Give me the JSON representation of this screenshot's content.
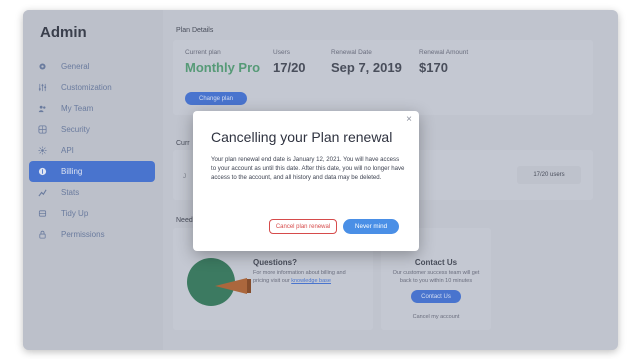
{
  "app": {
    "title": "Admin"
  },
  "sidebar": {
    "items": [
      {
        "label": "General",
        "icon": "gear-icon",
        "active": false
      },
      {
        "label": "Customization",
        "icon": "sliders-icon",
        "active": false
      },
      {
        "label": "My Team",
        "icon": "team-icon",
        "active": false
      },
      {
        "label": "Security",
        "icon": "shield-icon",
        "active": false
      },
      {
        "label": "API",
        "icon": "api-icon",
        "active": false
      },
      {
        "label": "Billing",
        "icon": "billing-icon",
        "active": true
      },
      {
        "label": "Stats",
        "icon": "stats-icon",
        "active": false
      },
      {
        "label": "Tidy Up",
        "icon": "broom-icon",
        "active": false
      },
      {
        "label": "Permissions",
        "icon": "lock-icon",
        "active": false
      }
    ]
  },
  "plan_details": {
    "section_title": "Plan Details",
    "current_plan_label": "Current plan",
    "current_plan_value": "Monthly Pro",
    "users_label": "Users",
    "users_value": "17/20",
    "renewal_date_label": "Renewal Date",
    "renewal_date_value": "Sep 7, 2019",
    "renewal_amount_label": "Renewal Amount",
    "renewal_amount_value": "$170",
    "change_plan_label": "Change plan"
  },
  "usage": {
    "section_label": "Curr",
    "left_text": "J",
    "users_pill": "17/20 users"
  },
  "help": {
    "section_label": "Need",
    "questions_title": "Questions?",
    "questions_text": "For more information about billing and pricing visit our",
    "knowledge_link": "knowledge base",
    "contact_title": "Contact Us",
    "contact_text": "Our customer success team will get back to you within 10 minutes",
    "contact_button": "Contact Us",
    "cancel_account": "Cancel my account"
  },
  "modal": {
    "title": "Cancelling your Plan renewal",
    "body": "Your plan renewal end date is January 12, 2021.  You will have access to your account as until this date.  After this date, you will no longer have access to the account, and all history and data may be deleted.",
    "cancel_button": "Cancel plan renewal",
    "never_mind_button": "Never mind",
    "close_symbol": "×"
  },
  "colors": {
    "accent": "#4a78d6",
    "danger": "#d64b4b",
    "primary_button": "#4a8fe6",
    "plan_green": "#58a07a"
  }
}
